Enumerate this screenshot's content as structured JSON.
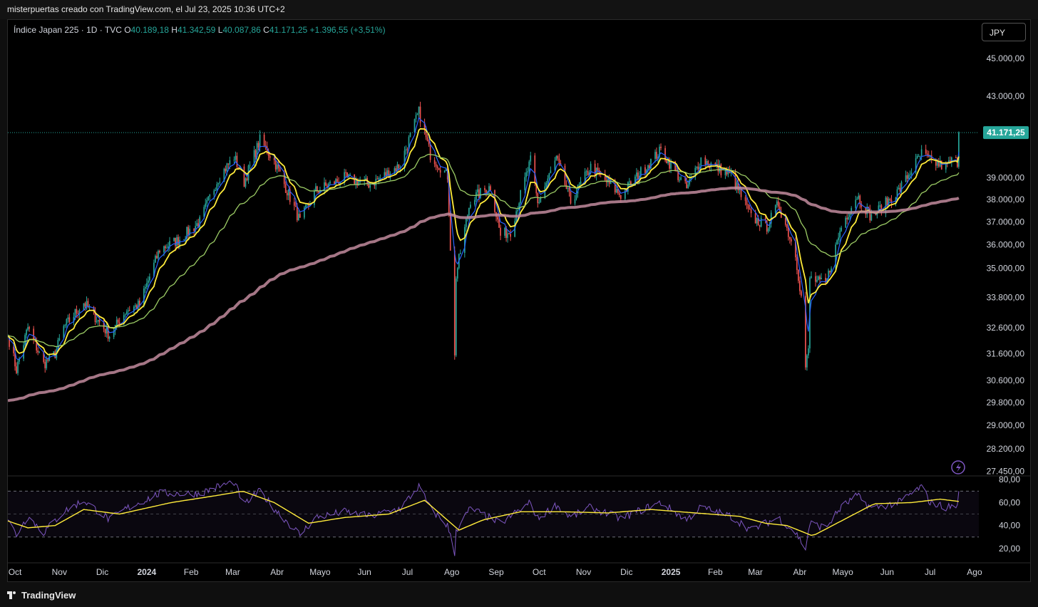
{
  "header": {
    "author_line": "misterpuertas creado con TradingView.com, el Jul 23, 2025 10:36 UTC+2"
  },
  "legend": {
    "symbol": "Índice Japan 225 · 1D · TVC",
    "o_label": "O",
    "open": "40.189,18",
    "h_label": "H",
    "high": "41.342,59",
    "l_label": "L",
    "low": "40.087,86",
    "c_label": "C",
    "close": "41.171,25",
    "change": "+1.396,55 (+3,51%)"
  },
  "currency_button": "JPY",
  "last_price_label": "41.171,25",
  "footer": {
    "brand": "TradingView"
  },
  "icons": [
    "lightning-icon",
    "tradingview-logo-icon"
  ],
  "colors": {
    "up": "#26a69a",
    "down": "#ef5350",
    "ema_fast": "#2962ff",
    "ema_mid": "#ffeb3b",
    "ema_slow": "#9ccc65",
    "ema_200": "#c28b9d",
    "rsi": "#7e57c2",
    "rsi_ma": "#ffeb3b",
    "price_tag": "#26a69a"
  },
  "chart_data": [
    {
      "type": "candlestick",
      "title": "Índice Japan 225 · 1D · TVC",
      "y_axis": {
        "scale": "log",
        "ylim": [
          27300,
          46000
        ],
        "ticks": [
          45000,
          43000,
          39000,
          38000,
          37000,
          36000,
          35000,
          33800,
          32600,
          31600,
          30600,
          29800,
          29000,
          28200,
          27450
        ],
        "tick_labels": [
          "45.000,00",
          "43.000,00",
          "39.000,00",
          "38.000,00",
          "37.000,00",
          "36.000,00",
          "35.000,00",
          "33.800,00",
          "32.600,00",
          "31.600,00",
          "30.600,00",
          "29.800,00",
          "29.000,00",
          "28.200,00",
          "27.450,00"
        ]
      },
      "x_axis": {
        "range": [
          "2023-09-28",
          "2025-08-06"
        ],
        "ticks": [
          {
            "date": "2023-10-01",
            "label": "Oct"
          },
          {
            "date": "2023-11-01",
            "label": "Nov"
          },
          {
            "date": "2023-12-01",
            "label": "Dic"
          },
          {
            "date": "2024-01-01",
            "label": "2024",
            "bold": true
          },
          {
            "date": "2024-02-01",
            "label": "Feb"
          },
          {
            "date": "2024-03-01",
            "label": "Mar"
          },
          {
            "date": "2024-04-01",
            "label": "Abr"
          },
          {
            "date": "2024-05-01",
            "label": "Mayo"
          },
          {
            "date": "2024-06-01",
            "label": "Jun"
          },
          {
            "date": "2024-07-01",
            "label": "Jul"
          },
          {
            "date": "2024-08-01",
            "label": "Ago"
          },
          {
            "date": "2024-09-01",
            "label": "Sep"
          },
          {
            "date": "2024-10-01",
            "label": "Oct"
          },
          {
            "date": "2024-11-01",
            "label": "Nov"
          },
          {
            "date": "2024-12-01",
            "label": "Dic"
          },
          {
            "date": "2025-01-01",
            "label": "2025",
            "bold": true
          },
          {
            "date": "2025-02-01",
            "label": "Feb"
          },
          {
            "date": "2025-03-01",
            "label": "Mar"
          },
          {
            "date": "2025-04-01",
            "label": "Abr"
          },
          {
            "date": "2025-05-01",
            "label": "Mayo"
          },
          {
            "date": "2025-06-01",
            "label": "Jun"
          },
          {
            "date": "2025-07-01",
            "label": "Jul"
          },
          {
            "date": "2025-08-01",
            "label": "Ago"
          }
        ]
      },
      "last_price": 41171.25,
      "close_anchors": [
        [
          "2023-09-28",
          32300
        ],
        [
          "2023-10-04",
          31000
        ],
        [
          "2023-10-12",
          32600
        ],
        [
          "2023-10-23",
          31200
        ],
        [
          "2023-10-31",
          31600
        ],
        [
          "2023-11-06",
          32600
        ],
        [
          "2023-11-20",
          33600
        ],
        [
          "2023-12-08",
          32300
        ],
        [
          "2023-12-20",
          33300
        ],
        [
          "2023-12-29",
          33500
        ],
        [
          "2024-01-12",
          35800
        ],
        [
          "2024-01-25",
          36200
        ],
        [
          "2024-02-09",
          37000
        ],
        [
          "2024-02-22",
          39000
        ],
        [
          "2024-03-04",
          40000
        ],
        [
          "2024-03-11",
          38800
        ],
        [
          "2024-03-22",
          40800
        ],
        [
          "2024-04-01",
          39800
        ],
        [
          "2024-04-19",
          37000
        ],
        [
          "2024-04-30",
          38400
        ],
        [
          "2024-05-20",
          39000
        ],
        [
          "2024-06-07",
          38700
        ],
        [
          "2024-06-28",
          39600
        ],
        [
          "2024-07-11",
          42200
        ],
        [
          "2024-07-19",
          40100
        ],
        [
          "2024-07-31",
          39100
        ],
        [
          "2024-08-02",
          35900
        ],
        [
          "2024-08-05",
          31460
        ],
        [
          "2024-08-06",
          34700
        ],
        [
          "2024-08-16",
          38000
        ],
        [
          "2024-08-30",
          38600
        ],
        [
          "2024-09-06",
          36400
        ],
        [
          "2024-09-13",
          36600
        ],
        [
          "2024-09-27",
          39800
        ],
        [
          "2024-10-02",
          37800
        ],
        [
          "2024-10-15",
          39900
        ],
        [
          "2024-10-25",
          37900
        ],
        [
          "2024-11-08",
          39500
        ],
        [
          "2024-11-29",
          38200
        ],
        [
          "2024-12-16",
          39500
        ],
        [
          "2024-12-27",
          40300
        ],
        [
          "2025-01-14",
          38500
        ],
        [
          "2025-01-24",
          39900
        ],
        [
          "2025-02-14",
          39100
        ],
        [
          "2025-02-28",
          37200
        ],
        [
          "2025-03-11",
          36800
        ],
        [
          "2025-03-19",
          37800
        ],
        [
          "2025-03-31",
          35600
        ],
        [
          "2025-04-04",
          33800
        ],
        [
          "2025-04-07",
          31100
        ],
        [
          "2025-04-09",
          31700
        ],
        [
          "2025-04-10",
          34600
        ],
        [
          "2025-04-21",
          34300
        ],
        [
          "2025-05-02",
          36800
        ],
        [
          "2025-05-13",
          38200
        ],
        [
          "2025-05-23",
          37200
        ],
        [
          "2025-06-11",
          38400
        ],
        [
          "2025-06-27",
          40150
        ],
        [
          "2025-07-03",
          39800
        ],
        [
          "2025-07-14",
          39500
        ],
        [
          "2025-07-18",
          39800
        ],
        [
          "2025-07-22",
          39774
        ],
        [
          "2025-07-23",
          41171.25
        ]
      ],
      "overlays": [
        {
          "name": "EMA rápida",
          "color": "#2962ff"
        },
        {
          "name": "EMA media",
          "color": "#ffeb3b"
        },
        {
          "name": "EMA lenta",
          "color": "#9ccc65"
        },
        {
          "name": "EMA 200",
          "color": "#c28b9d"
        }
      ]
    },
    {
      "type": "line",
      "panel": "oscillator",
      "ylim": [
        10,
        82
      ],
      "ticks": [
        80,
        60,
        40,
        20
      ],
      "tick_labels": [
        "80,00",
        "60,00",
        "40,00",
        "20,00"
      ],
      "band": [
        30,
        70
      ],
      "midline": 50,
      "series": [
        {
          "color": "#7e57c2",
          "anchors": [
            [
              "2023-09-28",
              45
            ],
            [
              "2023-10-04",
              32
            ],
            [
              "2023-10-12",
              48
            ],
            [
              "2023-10-23",
              34
            ],
            [
              "2023-11-06",
              52
            ],
            [
              "2023-11-20",
              62
            ],
            [
              "2023-12-08",
              45
            ],
            [
              "2023-12-20",
              55
            ],
            [
              "2024-01-12",
              68
            ],
            [
              "2024-02-09",
              68
            ],
            [
              "2024-02-22",
              74
            ],
            [
              "2024-03-04",
              78
            ],
            [
              "2024-03-11",
              58
            ],
            [
              "2024-03-22",
              70
            ],
            [
              "2024-04-01",
              55
            ],
            [
              "2024-04-19",
              32
            ],
            [
              "2024-04-30",
              47
            ],
            [
              "2024-05-20",
              52
            ],
            [
              "2024-06-07",
              48
            ],
            [
              "2024-06-28",
              55
            ],
            [
              "2024-07-11",
              74
            ],
            [
              "2024-07-19",
              55
            ],
            [
              "2024-07-31",
              40
            ],
            [
              "2024-08-05",
              16
            ],
            [
              "2024-08-06",
              36
            ],
            [
              "2024-08-16",
              55
            ],
            [
              "2024-09-06",
              42
            ],
            [
              "2024-09-27",
              60
            ],
            [
              "2024-10-02",
              46
            ],
            [
              "2024-10-15",
              58
            ],
            [
              "2024-10-25",
              47
            ],
            [
              "2024-11-08",
              56
            ],
            [
              "2024-11-29",
              46
            ],
            [
              "2024-12-16",
              55
            ],
            [
              "2024-12-27",
              60
            ],
            [
              "2025-01-14",
              45
            ],
            [
              "2025-01-24",
              56
            ],
            [
              "2025-02-14",
              48
            ],
            [
              "2025-02-28",
              36
            ],
            [
              "2025-03-19",
              47
            ],
            [
              "2025-03-31",
              34
            ],
            [
              "2025-04-07",
              20
            ],
            [
              "2025-04-10",
              42
            ],
            [
              "2025-04-21",
              38
            ],
            [
              "2025-05-02",
              56
            ],
            [
              "2025-05-13",
              66
            ],
            [
              "2025-05-23",
              55
            ],
            [
              "2025-06-11",
              60
            ],
            [
              "2025-06-27",
              74
            ],
            [
              "2025-07-03",
              60
            ],
            [
              "2025-07-14",
              56
            ],
            [
              "2025-07-22",
              57
            ],
            [
              "2025-07-23",
              70
            ]
          ]
        },
        {
          "color": "#ffeb3b",
          "anchors": [
            [
              "2023-09-28",
              44
            ],
            [
              "2023-10-12",
              38
            ],
            [
              "2023-10-31",
              40
            ],
            [
              "2023-11-20",
              54
            ],
            [
              "2023-12-15",
              50
            ],
            [
              "2024-01-20",
              60
            ],
            [
              "2024-02-20",
              66
            ],
            [
              "2024-03-10",
              70
            ],
            [
              "2024-04-01",
              60
            ],
            [
              "2024-04-25",
              42
            ],
            [
              "2024-05-20",
              47
            ],
            [
              "2024-06-20",
              50
            ],
            [
              "2024-07-15",
              62
            ],
            [
              "2024-08-08",
              36
            ],
            [
              "2024-08-25",
              45
            ],
            [
              "2024-09-20",
              52
            ],
            [
              "2024-10-20",
              52
            ],
            [
              "2024-11-20",
              51
            ],
            [
              "2024-12-20",
              54
            ],
            [
              "2025-01-20",
              51
            ],
            [
              "2025-02-20",
              48
            ],
            [
              "2025-03-10",
              42
            ],
            [
              "2025-03-25",
              40
            ],
            [
              "2025-04-12",
              31
            ],
            [
              "2025-05-05",
              46
            ],
            [
              "2025-05-25",
              59
            ],
            [
              "2025-06-20",
              60
            ],
            [
              "2025-07-10",
              63
            ],
            [
              "2025-07-23",
              61
            ]
          ]
        }
      ]
    }
  ]
}
